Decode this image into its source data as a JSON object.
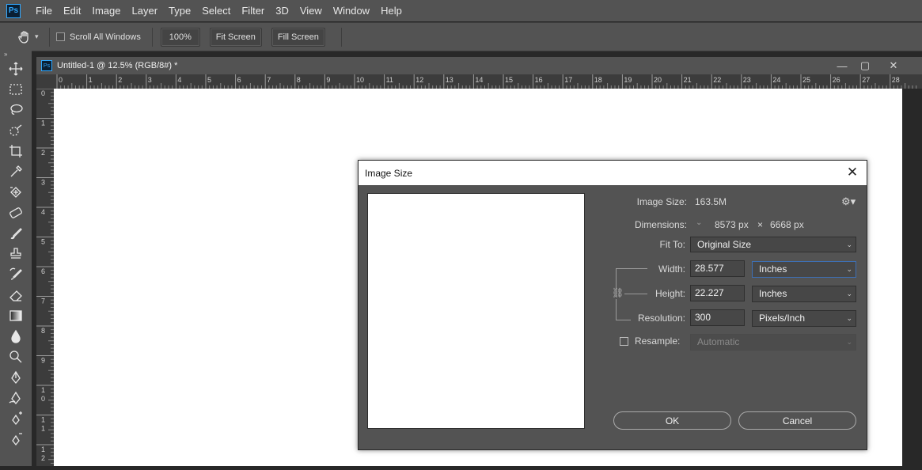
{
  "app": {
    "logo": "Ps"
  },
  "menu": [
    "File",
    "Edit",
    "Image",
    "Layer",
    "Type",
    "Select",
    "Filter",
    "3D",
    "View",
    "Window",
    "Help"
  ],
  "options": {
    "tool_icon": "hand-icon",
    "scroll_all_label": "Scroll All Windows",
    "zoom_100_label": "100%",
    "fit_screen_label": "Fit Screen",
    "fill_screen_label": "Fill Screen"
  },
  "toolbar": {
    "collapse_glyph": "»",
    "tools": [
      "move-icon",
      "marquee-icon",
      "lasso-icon",
      "quick-select-icon",
      "crop-icon",
      "eyedropper-icon",
      "healing-brush-icon",
      "patch-icon",
      "brush-icon",
      "stamp-icon",
      "history-brush-icon",
      "eraser-icon",
      "gradient-icon",
      "blur-icon",
      "dodge-icon",
      "pen-icon",
      "freeform-pen-icon",
      "add-anchor-icon",
      "delete-anchor-icon"
    ]
  },
  "document": {
    "tab_title": "Untitled-1 @ 12.5% (RGB/8#) *",
    "ruler_top": [
      "0",
      "1",
      "2",
      "3",
      "4",
      "5",
      "6",
      "7",
      "8",
      "9",
      "10",
      "11",
      "12",
      "13",
      "14",
      "15",
      "16",
      "17",
      "18",
      "19",
      "20",
      "21",
      "22",
      "23",
      "24",
      "25",
      "26",
      "27",
      "28"
    ],
    "ruler_left": [
      "0",
      "1",
      "2",
      "3",
      "4",
      "5",
      "6",
      "7",
      "8",
      "9",
      "1\n0",
      "1\n1",
      "1\n2"
    ]
  },
  "dialog": {
    "title": "Image Size",
    "image_size_label": "Image Size:",
    "image_size_value": "163.5M",
    "dimensions_label": "Dimensions:",
    "dim_width": "8573 px",
    "dim_times": "×",
    "dim_height": "6668 px",
    "fit_to_label": "Fit To:",
    "fit_to_value": "Original Size",
    "width_label": "Width:",
    "width_value": "28.577",
    "width_unit": "Inches",
    "height_label": "Height:",
    "height_value": "22.227",
    "height_unit": "Inches",
    "resolution_label": "Resolution:",
    "resolution_value": "300",
    "resolution_unit": "Pixels/Inch",
    "resample_label": "Resample:",
    "resample_value": "Automatic",
    "ok_label": "OK",
    "cancel_label": "Cancel"
  }
}
